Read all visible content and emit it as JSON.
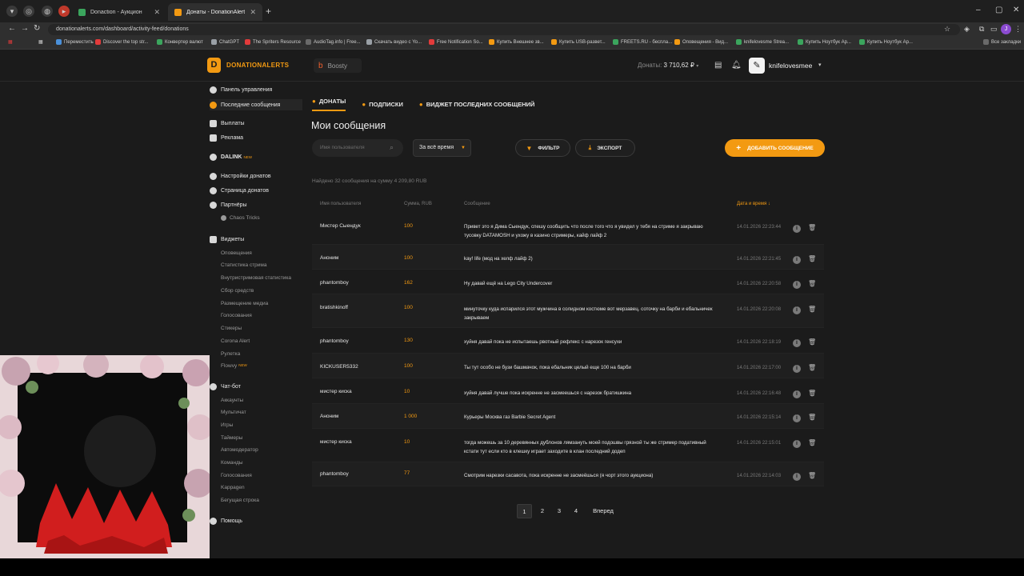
{
  "browser": {
    "tabs": [
      {
        "label": "Donaction - Аукцион",
        "color": "#3ba55d"
      },
      {
        "label": "Донаты - DonationAlerts",
        "color": "#f39a12"
      }
    ],
    "url": "donationalerts.com/dashboard/activity-feed/donations",
    "profile_letter": "J",
    "bookmarks": [
      {
        "label": "Переместить",
        "color": "#4a90d9"
      },
      {
        "label": "Discover the top str...",
        "color": "#e23b3b"
      },
      {
        "label": "Конвертер валют",
        "color": "#3ba55d"
      },
      {
        "label": "ChatGPT",
        "color": "#9aa0a6"
      },
      {
        "label": "The Spriters Resource",
        "color": "#e23b3b"
      },
      {
        "label": "AudioTag.info | Free...",
        "color": "#6a6a6a"
      },
      {
        "label": "Скачать видео с Yo...",
        "color": "#9aa0a6"
      },
      {
        "label": "Free Notification So...",
        "color": "#e23b3b"
      },
      {
        "label": "Купить Внешнее зв...",
        "color": "#f39a12"
      },
      {
        "label": "Купить USB-развет...",
        "color": "#f39a12"
      },
      {
        "label": "FREETS.RU - беспла...",
        "color": "#3ba55d"
      },
      {
        "label": "Оповещения - Вид...",
        "color": "#f39a12"
      },
      {
        "label": "knifelovesme Strea...",
        "color": "#3ba55d"
      },
      {
        "label": "Купить Ноутбук Ар...",
        "color": "#3ba55d"
      },
      {
        "label": "Купить Ноутбук Ар...",
        "color": "#3ba55d"
      }
    ],
    "all_bookmarks": "Все закладки"
  },
  "header": {
    "logo": "DONATIONALERTS",
    "boosty": "Boosty",
    "donats_label": "Донаты:",
    "donats_value": "3 710,62 ₽",
    "username": "knifelovesmee"
  },
  "sidebar": {
    "top_items": [
      {
        "label": "Панель управления",
        "icon": "dashboard-icon"
      },
      {
        "label": "Последние сообщения",
        "icon": "messages-icon"
      },
      {
        "label": "Выплаты",
        "icon": "payout-icon"
      },
      {
        "label": "Реклама",
        "icon": "ads-icon"
      },
      {
        "label": "DALINK",
        "icon": "dalink-icon",
        "badge": "NEW"
      },
      {
        "label": "Настройки донатов",
        "icon": "settings-icon"
      },
      {
        "label": "Страница донатов",
        "icon": "page-icon"
      },
      {
        "label": "Партнёры",
        "icon": "partners-icon"
      }
    ],
    "partner_sub": "Chaos Tricks",
    "widgets_label": "Виджеты",
    "widgets": [
      "Оповещения",
      "Статистика стрима",
      "Внутристримовая статистика",
      "Сбор средств",
      "Размещение медиа",
      "Голосования",
      "Стикеры",
      "Corona Alert",
      "Рулетка",
      "Flowvy"
    ],
    "flowvy_badge": "NEW",
    "chatbot_label": "Чат-бот",
    "chatbot": [
      "Аккаунты",
      "Мультичат",
      "Игры",
      "Таймеры",
      "Автомодератор",
      "Команды",
      "Голосования",
      "Kappagen",
      "Бегущая строка"
    ],
    "help": "Помощь"
  },
  "main": {
    "tabs": [
      "ДОНАТЫ",
      "ПОДПИСКИ",
      "ВИДЖЕТ ПОСЛЕДНИХ СООБЩЕНИЙ"
    ],
    "title": "Мои сообщения",
    "search_placeholder": "Имя пользователя",
    "period": "За всё время",
    "filter": "ФИЛЬТР",
    "export": "ЭКСПОРТ",
    "add": "ДОБАВИТЬ СООБЩЕНИЕ",
    "found": "Найдено 32 сообщения на сумму 4 209,80 RUB",
    "columns": [
      "Имя пользователя",
      "Сумма, RUB",
      "Сообщение",
      "Дата и время ↓"
    ],
    "rows": [
      {
        "user": "Мистер Сыендук",
        "sum": "100",
        "msg": "Привет это я Дима Сыендук, спешу сообщить что после того что я увидел у тебя на стриме я закрываю тусовку DATAMOSH и ухожу в казино стримеры, кайф лайф 2",
        "date": "14.01.2026 22:23:44"
      },
      {
        "user": "Аноним",
        "sum": "100",
        "msg": "kay! life (мод на хелф лайф 2)",
        "date": "14.01.2026 22:21:45"
      },
      {
        "user": "phantomboy",
        "sum": "162",
        "msg": "Ну давай ещё на Lego City Undercover",
        "date": "14.01.2026 22:20:58"
      },
      {
        "user": "bratishkinoff",
        "sum": "100",
        "msg": "минуточку куда испарился этот мужчина в солидном костюме вот мерзавец. соточку на барби и ебальничек закрываем",
        "date": "14.01.2026 22:20:08"
      },
      {
        "user": "phantomboy",
        "sum": "130",
        "msg": "хуйня давай пока не испытаешь рвотный рефлекс с нарезок генсухи",
        "date": "14.01.2026 22:18:19"
      },
      {
        "user": "KICKUSER5332",
        "sum": "100",
        "msg": "Ты тут особо не бузи башмачок, пока ебальник целый еще 100 на барби",
        "date": "14.01.2026 22:17:00"
      },
      {
        "user": "мистер киска",
        "sum": "10",
        "msg": "хуйня давай лучше пока искренне не засмеешься с нарезок братишкина",
        "date": "14.01.2026 22:16:48"
      },
      {
        "user": "Аноним",
        "sum": "1 000",
        "msg": "Курьеры Москва газ Barbie Secret Agent",
        "date": "14.01.2026 22:15:14"
      },
      {
        "user": "мистер киска",
        "sum": "10",
        "msg": "тогда можешь за 10 деревянных дублонов лямзануть моей подошвы грязной ты же стример подативный кстати тут если кто в клешку играет заходите в клан последний додеп",
        "date": "14.01.2026 22:15:01"
      },
      {
        "user": "phantomboy",
        "sum": "77",
        "msg": "Смотрим нарезки сасавота, пока искренне не засмеёшься (я чорт этого аукциона)",
        "date": "14.01.2026 22:14:03"
      }
    ],
    "pages": [
      "1",
      "2",
      "3",
      "4"
    ],
    "next": "Вперед"
  },
  "colors": {
    "accent": "#f39a12",
    "background": "#1b1b1b"
  }
}
